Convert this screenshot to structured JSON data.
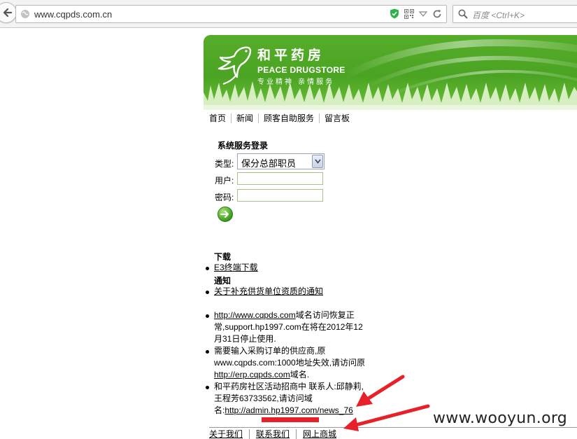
{
  "browser": {
    "url": "www.cqpds.com.cn",
    "search_placeholder": "百度 <Ctrl+K>",
    "icons": [
      "back-arrow-icon",
      "globe-icon",
      "shield-icon",
      "qr-code-icon",
      "dropdown-icon",
      "reload-icon",
      "search-icon"
    ]
  },
  "banner": {
    "name_cn": "和平药房",
    "name_en": "PEACE DRUGSTORE",
    "slogan": "专业精神 亲情服务",
    "logo_icon": "dove-icon"
  },
  "nav": [
    "首页",
    "新闻",
    "顾客自助服务",
    "留言板"
  ],
  "login": {
    "title": "系统服务登录",
    "type_label": "类型:",
    "type_value": "保分总部职员",
    "user_label": "用户:",
    "password_label": "密码:",
    "submit_icon": "go-arrow-icon"
  },
  "downloads": {
    "heading": "下载",
    "items": [
      "E3终端下载"
    ]
  },
  "notices": {
    "heading": "通知",
    "items": [
      "关于补充供货单位资质的通知"
    ]
  },
  "messages": {
    "m1_link": "http://www.cqpds.com",
    "m1_text": "域名访问恢复正常,support.hp1997.com在将在2012年12月31日停止使用.",
    "m2_text": "需要输入采购订单的供应商,原www.cqpds.com:1000地址失效,请访问原",
    "m2_link": "http://erp.cqpds.com",
    "m2_suffix": "域名.",
    "m3_text": "和平药房社区活动招商中 联系人:邱静莉,王程芳63733562,请访问域名:",
    "m3_link": "http://admin.hp1997.com/news_76"
  },
  "footer": [
    "关于我们",
    "联系我们",
    "网上商城"
  ],
  "watermark": "www.wooyun.org",
  "colors": {
    "banner_green": "#4aa322",
    "annotation_red": "#e8202a"
  }
}
